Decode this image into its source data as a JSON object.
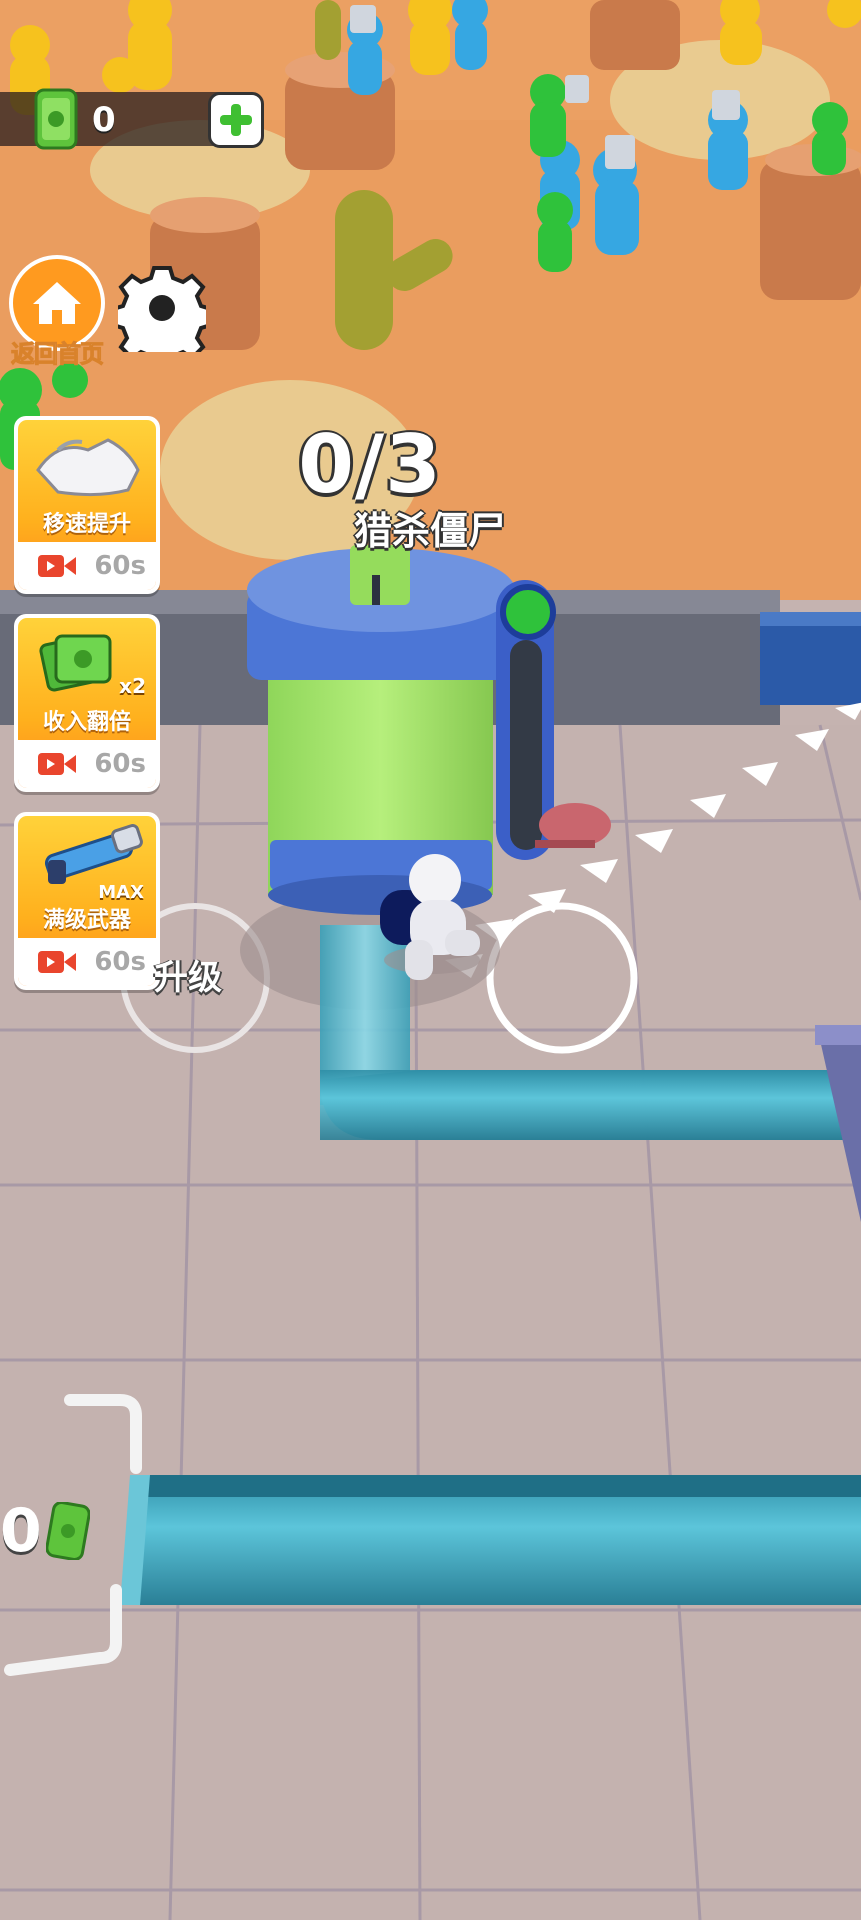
{
  "hud": {
    "money": "0",
    "home_label": "返回首页",
    "icons": [
      "cash-icon",
      "plus-icon",
      "home-icon",
      "gear-icon",
      "video-icon"
    ]
  },
  "boosts": [
    {
      "title": "移速提升",
      "time": "60s",
      "icon": "speed-boot-icon"
    },
    {
      "title": "收入翻倍",
      "time": "60s",
      "icon": "cash-stack-icon",
      "badge": "x2"
    },
    {
      "title": "满级武器",
      "time": "60s",
      "icon": "blaster-icon",
      "badge": "MAX"
    }
  ],
  "task": {
    "progress": "0/3",
    "label": "猎杀僵尸"
  },
  "world": {
    "upgrade_label": "升级",
    "price_prefix": "0"
  },
  "colors": {
    "accent_orange": "#ff9a1f",
    "sand": "#eba063",
    "floor": "#c5b3b0",
    "tank_liquid": "#a7e36a",
    "tank_blue": "#4c76d6",
    "pipe": "#3fb0c8"
  }
}
